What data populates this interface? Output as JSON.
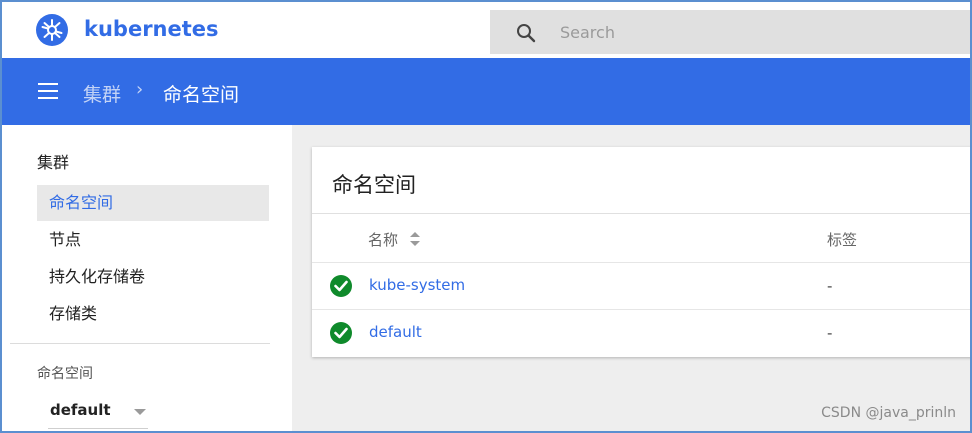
{
  "header": {
    "brand": "kubernetes",
    "search": {
      "placeholder": "Search"
    }
  },
  "toolbar": {
    "breadcrumb": [
      "集群",
      "命名空间"
    ],
    "separator": "›"
  },
  "sidebar": {
    "section_title": "集群",
    "items": [
      {
        "label": "命名空间",
        "active": true
      },
      {
        "label": "节点",
        "active": false
      },
      {
        "label": "持久化存储卷",
        "active": false
      },
      {
        "label": "存储类",
        "active": false
      }
    ],
    "namespace_label": "命名空间",
    "namespace_selected": "default"
  },
  "card": {
    "title": "命名空间",
    "columns": [
      "名称",
      "标签"
    ],
    "rows": [
      {
        "name": "kube-system",
        "labels": "-",
        "status": "ok"
      },
      {
        "name": "default",
        "labels": "-",
        "status": "ok"
      }
    ]
  },
  "watermark": "CSDN @java_prinln",
  "colors": {
    "accent": "#326ce5",
    "status_ok": "#0f8a2b",
    "border": "#5b8fd0"
  },
  "icons": [
    "kubernetes-logo-icon",
    "search-icon",
    "menu-icon",
    "sort-icon",
    "check-circle-icon",
    "chevron-down-icon"
  ]
}
